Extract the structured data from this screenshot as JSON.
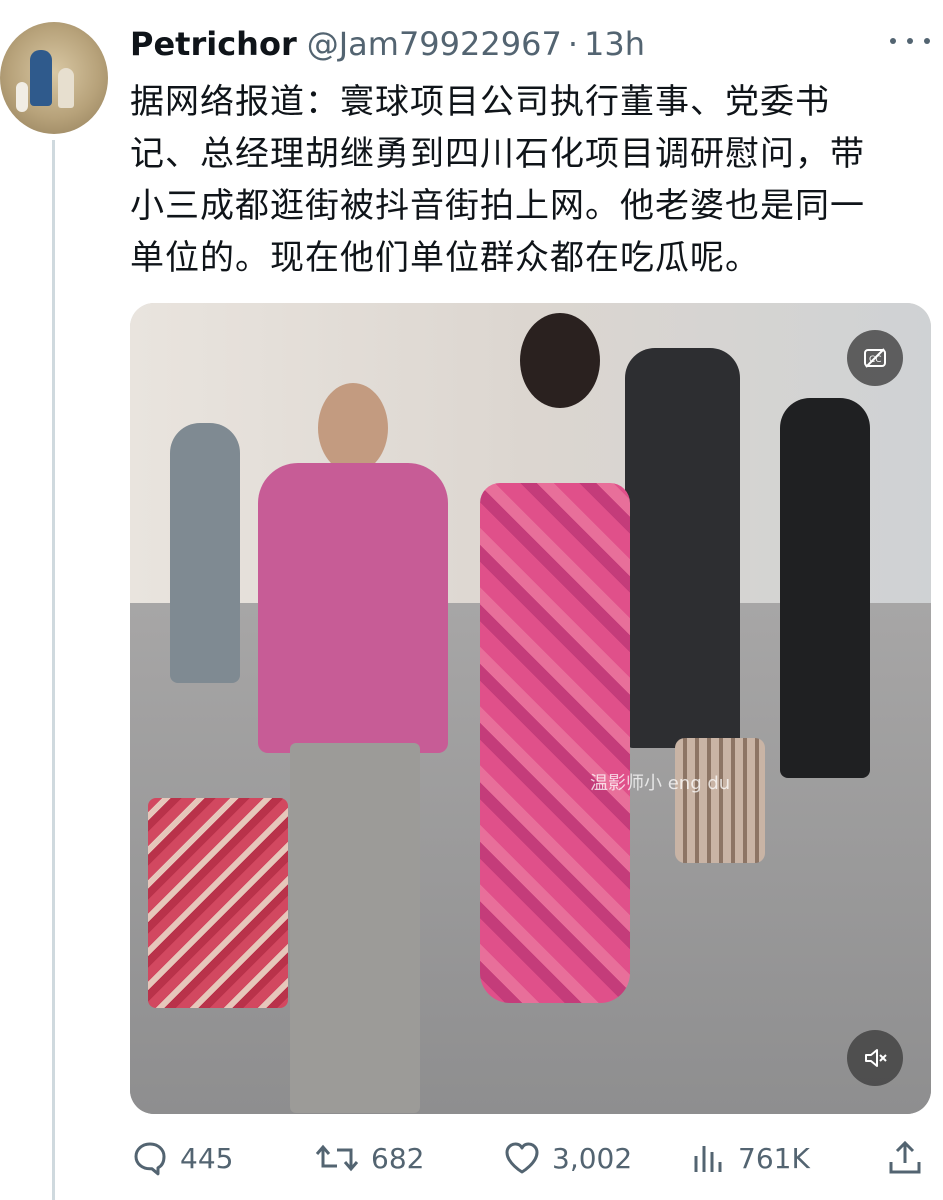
{
  "tweet": {
    "display_name": "Petrichor",
    "handle": "@Jam79922967",
    "separator": "·",
    "time": "13h",
    "text_lines": [
      "据网络报道：寰球项目公司执行董事、党委书",
      "记、总经理胡继勇到四川石化项目调研慰问，带",
      "小三成都逛街被抖音街拍上网。他老婆也是同一",
      "单位的。现在他们单位群众都在吃瓜呢。"
    ],
    "media": {
      "watermark": "温影师小 eng du"
    },
    "stats": {
      "replies": "445",
      "retweets": "682",
      "likes": "3,002",
      "views": "761K"
    }
  },
  "icons": {
    "more": "more-horizontal-icon",
    "captions": "captions-off-icon",
    "mute": "volume-muted-icon",
    "reply": "reply-icon",
    "retweet": "retweet-icon",
    "like": "heart-icon",
    "views": "views-icon",
    "share": "share-icon"
  },
  "colors": {
    "text": "#0f1419",
    "secondary": "#536471",
    "thread_line": "#cfd9de"
  }
}
